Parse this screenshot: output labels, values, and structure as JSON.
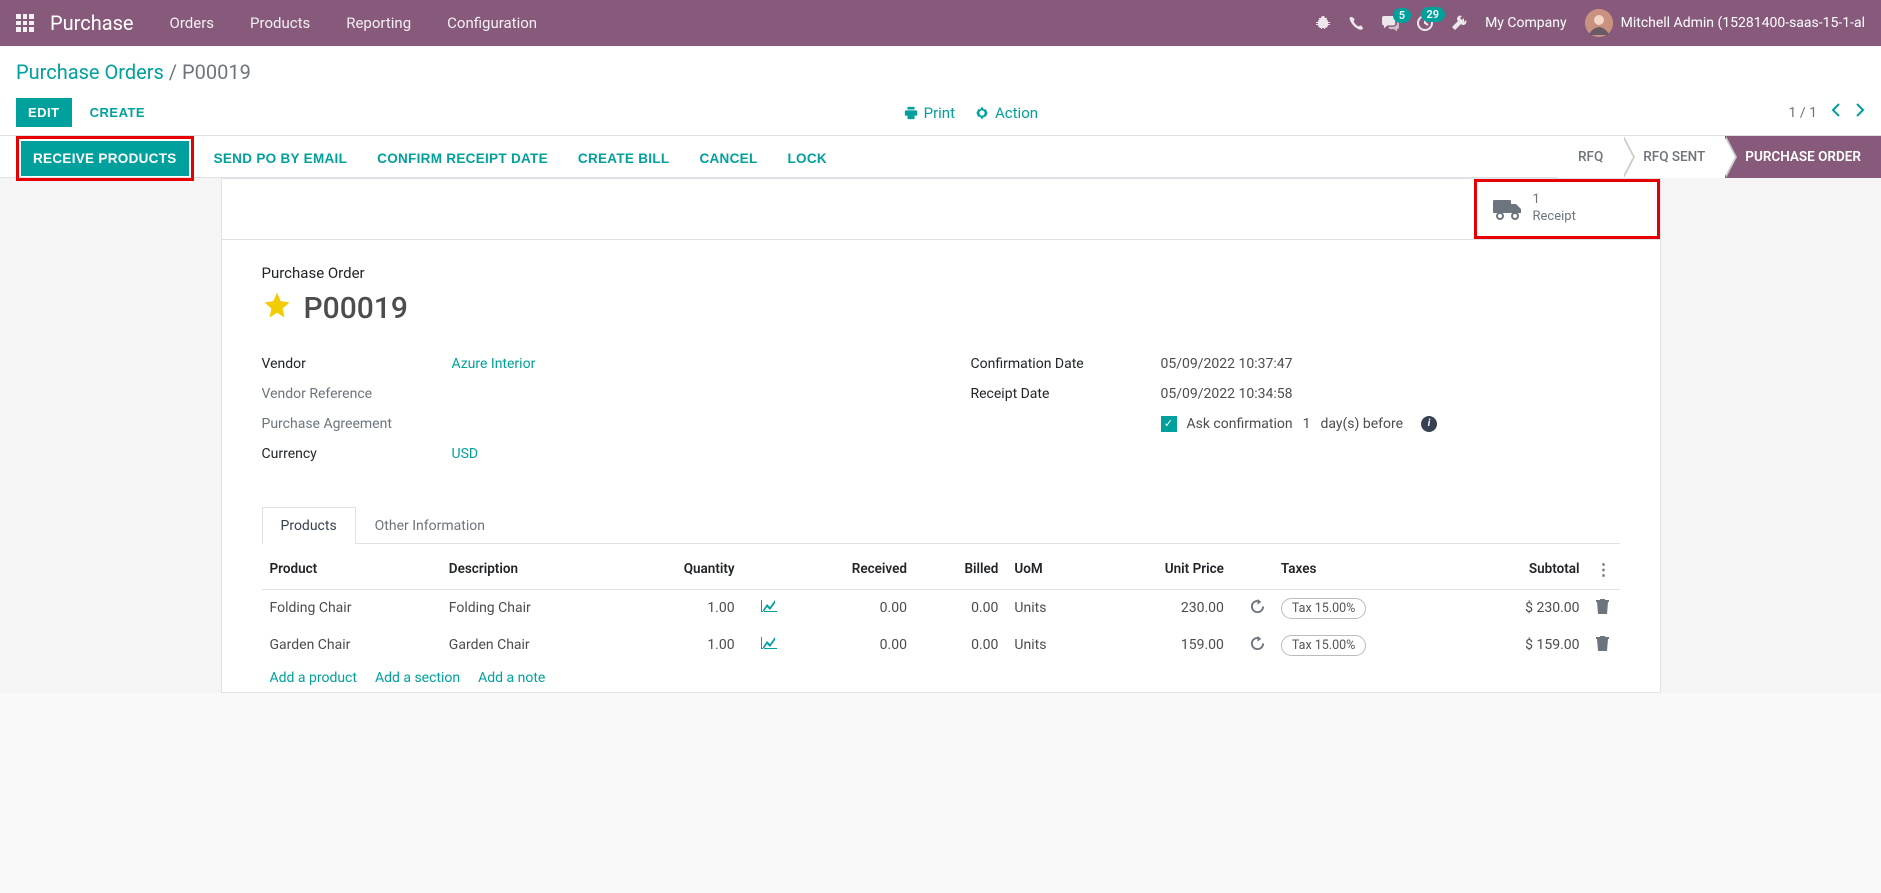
{
  "navbar": {
    "brand": "Purchase",
    "menu": [
      "Orders",
      "Products",
      "Reporting",
      "Configuration"
    ],
    "msg_badge": "5",
    "activity_badge": "29",
    "company": "My Company",
    "user": "Mitchell Admin (15281400-saas-15-1-al"
  },
  "breadcrumb": {
    "parent": "Purchase Orders",
    "current": "P00019"
  },
  "cp": {
    "edit": "EDIT",
    "create": "CREATE",
    "print": "Print",
    "action": "Action",
    "pager": "1 / 1"
  },
  "status_buttons": {
    "receive": "RECEIVE PRODUCTS",
    "send": "SEND PO BY EMAIL",
    "confirm_date": "CONFIRM RECEIPT DATE",
    "create_bill": "CREATE BILL",
    "cancel": "CANCEL",
    "lock": "LOCK"
  },
  "stages": {
    "rfq": "RFQ",
    "rfq_sent": "RFQ SENT",
    "po": "PURCHASE ORDER"
  },
  "stat": {
    "count": "1",
    "label": "Receipt"
  },
  "record": {
    "type_label": "Purchase Order",
    "name": "P00019"
  },
  "fields": {
    "vendor_label": "Vendor",
    "vendor": "Azure Interior",
    "vendor_ref_label": "Vendor Reference",
    "purchase_agreement_label": "Purchase Agreement",
    "currency_label": "Currency",
    "currency": "USD",
    "confirm_date_label": "Confirmation Date",
    "confirm_date": "05/09/2022 10:37:47",
    "receipt_date_label": "Receipt Date",
    "receipt_date": "05/09/2022 10:34:58",
    "ask_text_1": "Ask confirmation",
    "ask_days": "1",
    "ask_text_2": "day(s) before"
  },
  "tabs": {
    "products": "Products",
    "other": "Other Information"
  },
  "table": {
    "headers": {
      "product": "Product",
      "description": "Description",
      "quantity": "Quantity",
      "received": "Received",
      "billed": "Billed",
      "uom": "UoM",
      "unit_price": "Unit Price",
      "taxes": "Taxes",
      "subtotal": "Subtotal"
    },
    "rows": [
      {
        "product": "Folding Chair",
        "description": "Folding Chair",
        "qty": "1.00",
        "received": "0.00",
        "billed": "0.00",
        "uom": "Units",
        "price": "230.00",
        "tax": "Tax 15.00%",
        "subtotal": "$ 230.00"
      },
      {
        "product": "Garden Chair",
        "description": "Garden Chair",
        "qty": "1.00",
        "received": "0.00",
        "billed": "0.00",
        "uom": "Units",
        "price": "159.00",
        "tax": "Tax 15.00%",
        "subtotal": "$ 159.00"
      }
    ],
    "add_product": "Add a product",
    "add_section": "Add a section",
    "add_note": "Add a note"
  }
}
